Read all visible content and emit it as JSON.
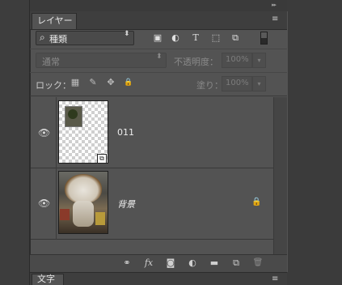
{
  "panel": {
    "tab_label": "レイヤー",
    "menu_icon": "≡",
    "collapse_icon": "▸▸"
  },
  "filter": {
    "search_icon": "⌕",
    "label": "種類",
    "arrows": "⬍",
    "icons": [
      "image-filter-icon",
      "adjustment-filter-icon",
      "type-filter-icon",
      "shape-filter-icon",
      "smart-object-filter-icon"
    ],
    "glyphs": [
      "▣",
      "◐",
      "T",
      "⬚",
      "⧉"
    ]
  },
  "blend": {
    "mode": "通常",
    "arrows": "⬍",
    "opacity_label": "不透明度：",
    "opacity_value": "100%",
    "dropdown_arrow": "▾"
  },
  "lock": {
    "label": "ロック：",
    "glyphs": [
      "▦",
      "✎",
      "✥",
      "🔒"
    ],
    "fill_label": "塗り：",
    "fill_value": "100%",
    "dropdown_arrow": "▾"
  },
  "layers": [
    {
      "name": "011",
      "visible": true,
      "eye": "👁",
      "smart_badge": "⧉"
    },
    {
      "name": "背景",
      "visible": true,
      "eye": "👁",
      "locked": true,
      "lock_icon": "🔒"
    }
  ],
  "bottom_bar": {
    "glyphs": [
      "⚭",
      "fx",
      "◙",
      "◐",
      "▬",
      "⧉",
      "🗑"
    ]
  },
  "second_panel": {
    "tab_label": "文字",
    "menu_icon": "≡"
  }
}
